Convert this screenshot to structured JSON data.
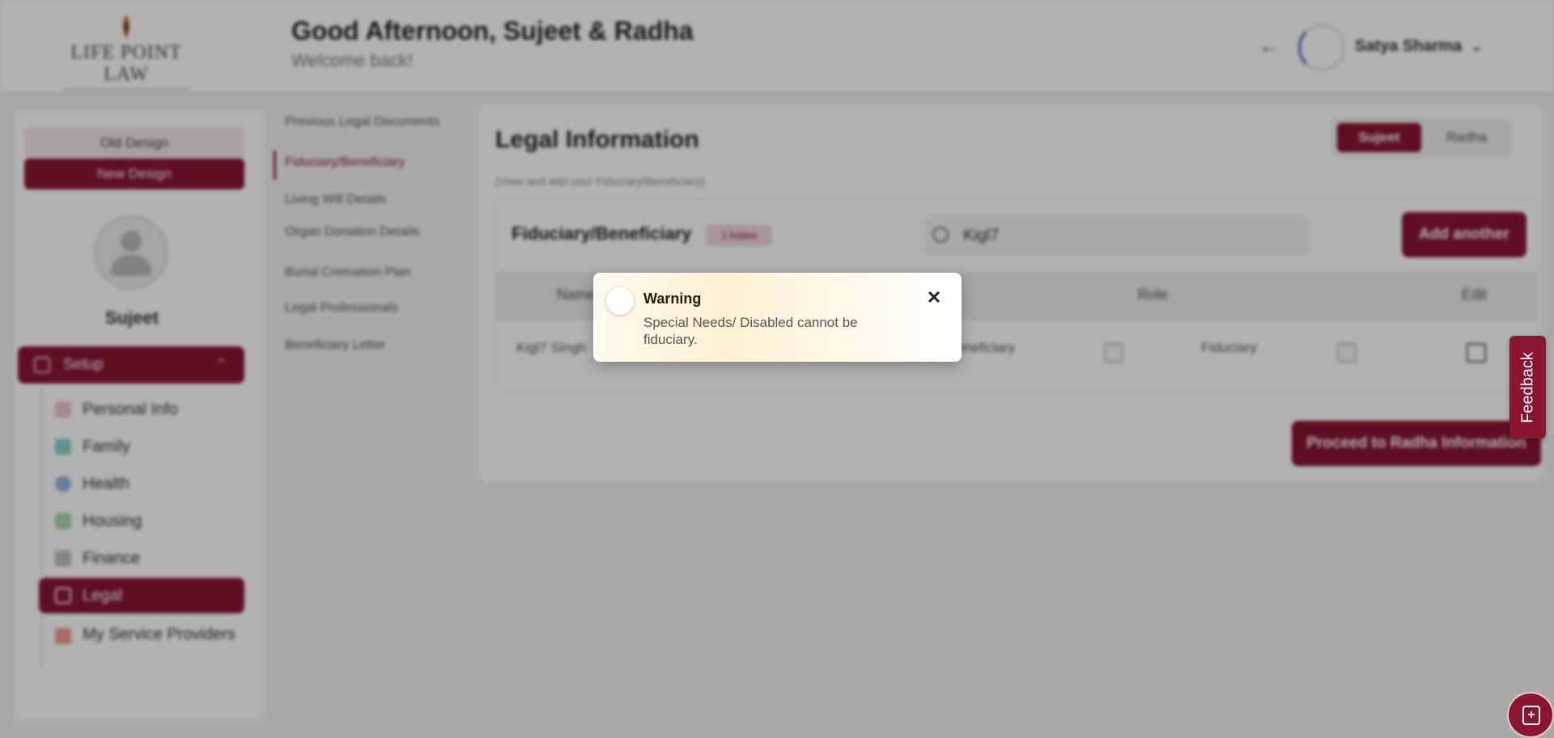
{
  "header": {
    "logo_text": "LIFE POINT LAW",
    "greeting": "Good Afternoon, Sujeet & Radha",
    "welcome": "Welcome back!",
    "user_name": "Satya Sharma"
  },
  "sidebar": {
    "old_design": "Old Design",
    "new_design": "New Design",
    "profile_name": "Sujeet",
    "setup_label": "Setup",
    "items": [
      {
        "label": "Personal Info",
        "icon": "person-icon",
        "color": "#d77a8a"
      },
      {
        "label": "Family",
        "icon": "family-icon",
        "color": "#2aa7a0"
      },
      {
        "label": "Health",
        "icon": "health-icon",
        "color": "#4a74c9"
      },
      {
        "label": "Housing",
        "icon": "house-icon",
        "color": "#55b05a"
      },
      {
        "label": "Finance",
        "icon": "finance-icon",
        "color": "#666666"
      },
      {
        "label": "Legal",
        "icon": "legal-icon",
        "color": "#ffffff"
      },
      {
        "label": "My Service Providers",
        "icon": "providers-icon",
        "color": "#e0443b"
      }
    ]
  },
  "subnav": {
    "items": [
      "Previous Legal Documents",
      "Fiduciary/Beneficiary",
      "Living Will Details",
      "Organ Donation Details",
      "Burial Cremation Plan",
      "Legal Professionals",
      "Beneficiary Letter"
    ]
  },
  "main": {
    "title": "Legal Information",
    "subtitle": "(View and add your Fiduciary/Beneficiary)",
    "tabs": [
      "Sujeet",
      "Radha"
    ],
    "card_title": "Fiduciary/Beneficiary",
    "badge": "1 Added",
    "search_value": "Kigl7",
    "add_button": "Add another",
    "columns": [
      "Name",
      "Role",
      "Edit"
    ],
    "row": {
      "name": "Kigl7 Singh",
      "beneficiary": "Beneficiary",
      "fiduciary": "Fiduciary"
    },
    "proceed_button": "Proceed to Radha Information"
  },
  "toast": {
    "title": "Warning",
    "message": "Special Needs/ Disabled cannot be fiduciary."
  },
  "feedback": {
    "label": "Feedback"
  },
  "colors": {
    "brand": "#8a1530",
    "toast_bg": "#fff1d2"
  }
}
